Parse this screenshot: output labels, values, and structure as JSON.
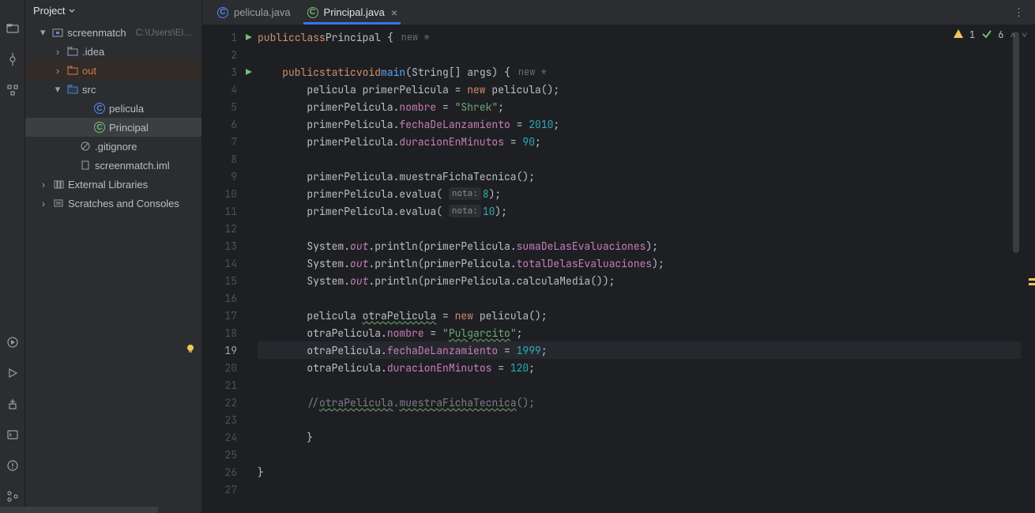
{
  "sidebar": {
    "title": "Project",
    "tree": {
      "root": "screenmatch",
      "rootPath": "C:\\Users\\Elena",
      "idea": ".idea",
      "out": "out",
      "src": "src",
      "pelicula": "pelicula",
      "principal": "Principal",
      "gitignore": ".gitignore",
      "iml": "screenmatch.iml",
      "extlibs": "External Libraries",
      "scratches": "Scratches and Consoles"
    }
  },
  "tabs": {
    "tab1": "pelicula.java",
    "tab2": "Principal.java"
  },
  "inspections": {
    "warn": "1",
    "ok": "6"
  },
  "hints": {
    "newstar": "new *",
    "nota": "nota:"
  },
  "code": {
    "l1a": "public",
    "l1b": "class",
    "l1c": "Principal",
    "l1d": " {",
    "l3a": "    ",
    "l3b": "public",
    "l3c": "static",
    "l3d": "void",
    "l3e": "main",
    "l3f": "(String[] args) {",
    "l4a": "        pelicula primerPelicula = ",
    "l4b": "new",
    "l4c": " pelicula();",
    "l5a": "        primerPelicula.",
    "l5b": "nombre",
    "l5c": " = ",
    "l5d": "\"Shrek\"",
    "l5e": ";",
    "l6a": "        primerPelicula.",
    "l6b": "fechaDeLanzamiento",
    "l6c": " = ",
    "l6d": "2010",
    "l6e": ";",
    "l7a": "        primerPelicula.",
    "l7b": "duracionEnMinutos",
    "l7c": " = ",
    "l7d": "90",
    "l7e": ";",
    "l9a": "        primerPelicula.muestraFichaTecnica();",
    "l10a": "        primerPelicula.evalua( ",
    "l10b": "8",
    "l10c": ");",
    "l11a": "        primerPelicula.evalua( ",
    "l11b": "10",
    "l11c": ");",
    "l13a": "        System.",
    "l13b": "out",
    "l13c": ".println(primerPelicula.",
    "l13d": "sumaDeLasEvaluaciones",
    "l13e": ");",
    "l14a": "        System.",
    "l14b": "out",
    "l14c": ".println(primerPelicula.",
    "l14d": "totalDelasEvaluaciones",
    "l14e": ");",
    "l15a": "        System.",
    "l15b": "out",
    "l15c": ".println(primerPelicula.calculaMedia());",
    "l17a": "        pelicula ",
    "l17b": "otraPelicula",
    "l17c": " = ",
    "l17d": "new",
    "l17e": " pelicula();",
    "l18a": "        otraPelicula.",
    "l18b": "nombre",
    "l18c": " = ",
    "l18d": "\"",
    "l18e": "Pulgarcito",
    "l18f": "\"",
    "l18g": ";",
    "l19a": "        otraPelicula.",
    "l19b": "fechaDeLanzamiento",
    "l19c": " = ",
    "l19d": "1999",
    "l19e": ";",
    "l20a": "        otraPelicula.",
    "l20b": "duracionEnMinutos",
    "l20c": " = ",
    "l20d": "120",
    "l20e": ";",
    "l22a": "        //",
    "l22b": "otraPelicula",
    "l22c": ".",
    "l22d": "muestraFichaTecnica",
    "l22e": "();",
    "l24a": "        }",
    "l26a": "}"
  },
  "lines": [
    "1",
    "2",
    "3",
    "4",
    "5",
    "6",
    "7",
    "8",
    "9",
    "10",
    "11",
    "12",
    "13",
    "14",
    "15",
    "16",
    "17",
    "18",
    "19",
    "20",
    "21",
    "22",
    "23",
    "24",
    "25",
    "26",
    "27"
  ]
}
